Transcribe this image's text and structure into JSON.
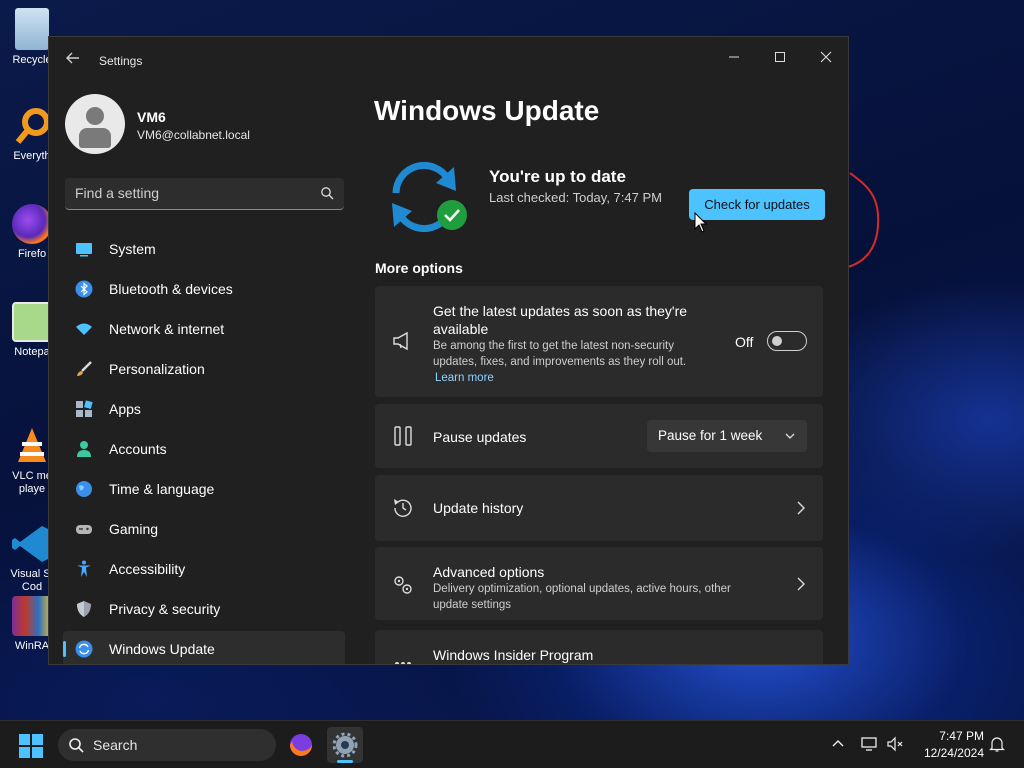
{
  "desktop": {
    "icons": [
      {
        "label": "Recycle",
        "icon": "recycle-bin-icon"
      },
      {
        "label": "Everyth",
        "icon": "everything-search-icon"
      },
      {
        "label": "Firefo",
        "icon": "firefox-icon"
      },
      {
        "label": "Notepa",
        "icon": "notepad-icon"
      },
      {
        "label": "VLC me\nplaye",
        "icon": "vlc-icon"
      },
      {
        "label": "Visual St\nCod",
        "icon": "vscode-icon"
      },
      {
        "label": "WinRA",
        "icon": "winrar-icon"
      }
    ]
  },
  "window": {
    "title": "Settings",
    "back_icon": "back-arrow-icon",
    "controls": [
      "minimize-icon",
      "maximize-icon",
      "close-icon"
    ]
  },
  "sidebar": {
    "profile": {
      "name": "VM6",
      "email": "VM6@collabnet.local"
    },
    "search": {
      "placeholder": "Find a setting",
      "value": ""
    },
    "items": [
      {
        "label": "System",
        "icon": "system-icon",
        "color": "#4cc2ff"
      },
      {
        "label": "Bluetooth & devices",
        "icon": "bluetooth-icon",
        "color": "#3b8eea"
      },
      {
        "label": "Network & internet",
        "icon": "wifi-icon",
        "color": "#4cc2ff"
      },
      {
        "label": "Personalization",
        "icon": "brush-icon",
        "color": "#e8a24a"
      },
      {
        "label": "Apps",
        "icon": "apps-icon",
        "color": "#a9b8c9"
      },
      {
        "label": "Accounts",
        "icon": "accounts-icon",
        "color": "#3cc9a0"
      },
      {
        "label": "Time & language",
        "icon": "globe-icon",
        "color": "#3b8eea"
      },
      {
        "label": "Gaming",
        "icon": "gamepad-icon",
        "color": "#b5b5b5"
      },
      {
        "label": "Accessibility",
        "icon": "accessibility-icon",
        "color": "#4ca8ff"
      },
      {
        "label": "Privacy & security",
        "icon": "shield-icon",
        "color": "#9aa3ad"
      },
      {
        "label": "Windows Update",
        "icon": "update-icon",
        "color": "#4cc2ff",
        "active": true
      }
    ]
  },
  "main": {
    "title": "Windows Update",
    "status": {
      "title": "You're up to date",
      "subtitle": "Last checked: Today, 7:47 PM",
      "button": "Check for updates"
    },
    "more_options_label": "More options",
    "cards": {
      "latest": {
        "title_line1": "Get the latest updates as soon as they're",
        "title_line2": "available",
        "desc_line1": "Be among the first to get the latest non-security",
        "desc_line2": "updates, fixes, and improvements as they roll out.",
        "link": "Learn more",
        "toggle_label": "Off",
        "toggle_on": false
      },
      "pause": {
        "title": "Pause updates",
        "dropdown_value": "Pause for 1 week"
      },
      "history": {
        "title": "Update history"
      },
      "advanced": {
        "title": "Advanced options",
        "desc_line1": "Delivery optimization, optional updates, active hours, other",
        "desc_line2": "update settings"
      },
      "insider": {
        "title": "Windows Insider Program"
      }
    }
  },
  "taskbar": {
    "search_label": "Search",
    "time": "7:47 PM",
    "date": "12/24/2024"
  },
  "colors": {
    "accent": "#4cc2ff",
    "window_bg": "#202020",
    "card_bg": "#2b2b2b"
  }
}
